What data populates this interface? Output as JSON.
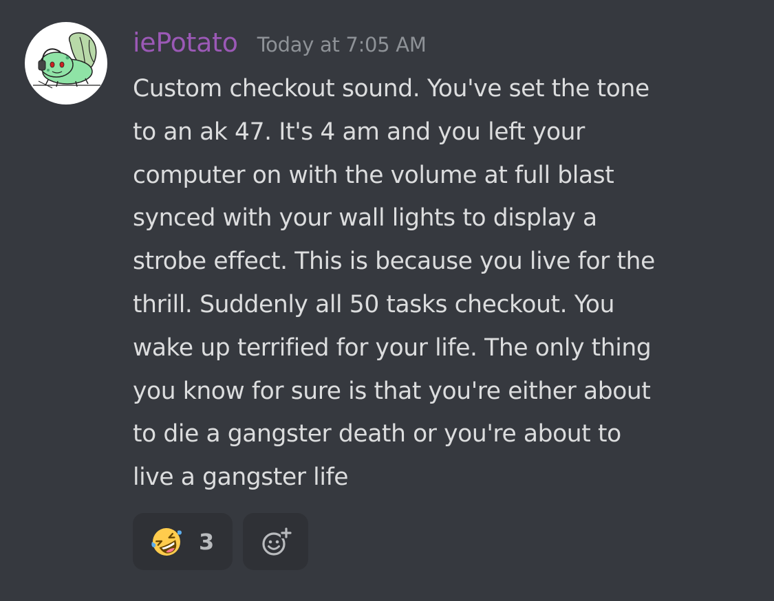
{
  "message": {
    "author": {
      "username": "iePotato",
      "username_color": "#9b59b6",
      "avatar_icon": "bulbasaur-with-headphones"
    },
    "timestamp": "Today at 7:05 AM",
    "content_lines": [
      "Custom checkout sound. You've set the tone",
      "to an ak 47. It's 4 am and you left your",
      "computer on with the volume at full blast",
      "synced with your wall lights to display a",
      "strobe effect. This is because you live for the",
      "thrill. Suddenly all 50 tasks checkout. You",
      "wake up terrified for your life. The only thing",
      "you know for sure is that you're either about",
      "to die a gangster death or you're about to",
      "live a gangster life"
    ],
    "reactions": [
      {
        "emoji_icon": "rolling-on-the-floor-laughing-emoji",
        "count": "3"
      }
    ],
    "add_reaction_icon": "add-reaction-icon"
  },
  "colors": {
    "background": "#36393f",
    "text": "#dcddde",
    "timestamp": "#8e9297",
    "reaction_bg": "#2f3136"
  }
}
